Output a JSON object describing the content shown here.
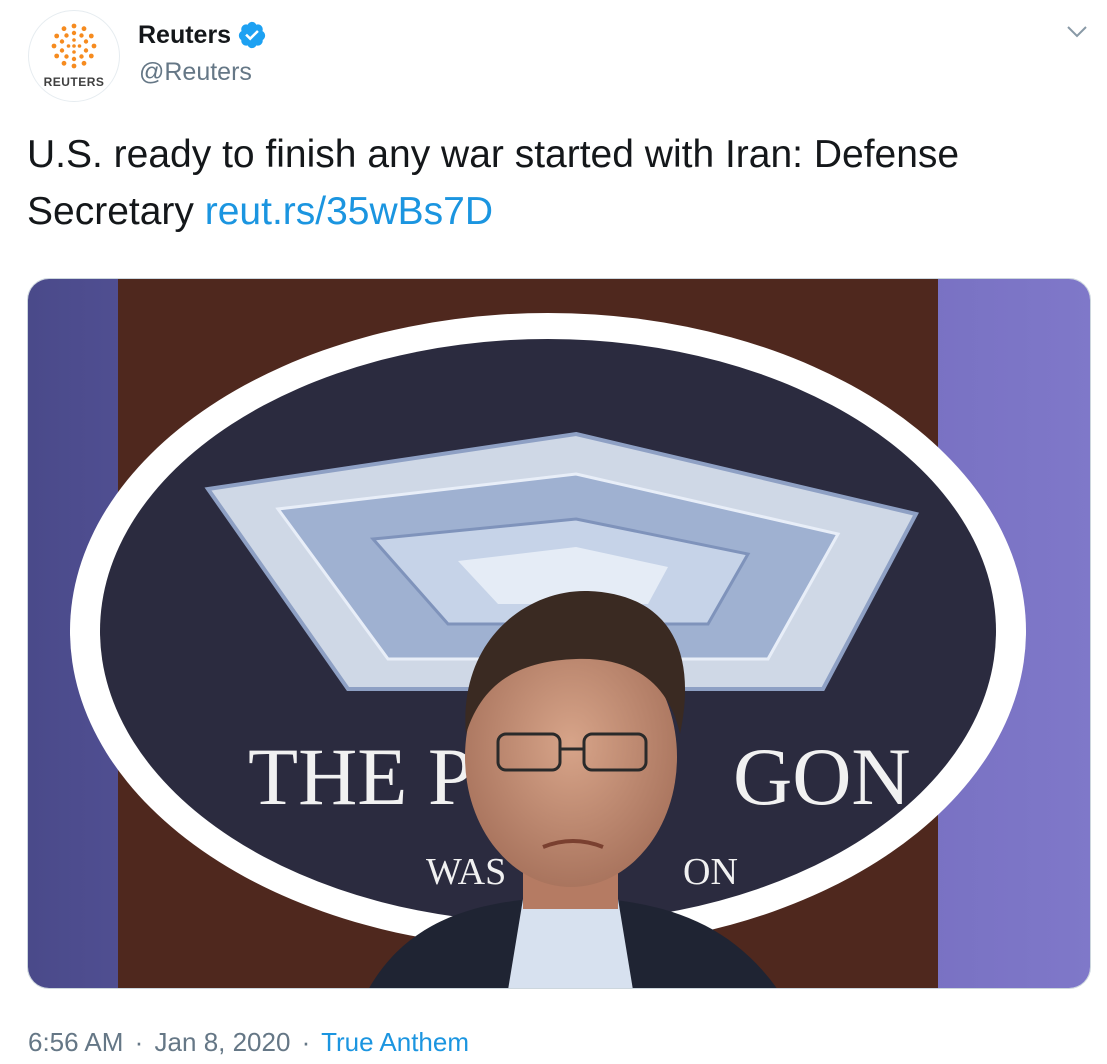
{
  "header": {
    "avatar_wordmark": "REUTERS",
    "display_name": "Reuters",
    "handle": "@Reuters",
    "verified": true
  },
  "tweet": {
    "text": "U.S. ready to finish any war started with Iran: Defense Secretary",
    "link": "reut.rs/35wBs7D"
  },
  "media": {
    "description_icon": "photo",
    "sign_text_line1_left": "THE P",
    "sign_text_line1_right": "GON",
    "sign_text_line2_left": "WAS",
    "sign_text_line2_right": "ON"
  },
  "meta": {
    "time": "6:56 AM",
    "separator": "·",
    "date": "Jan 8, 2020",
    "source": "True Anthem"
  },
  "colors": {
    "link": "#1b95e0",
    "secondary_text": "#657786",
    "verified": "#1da1f2",
    "reuters_orange": "#f68b1f"
  }
}
